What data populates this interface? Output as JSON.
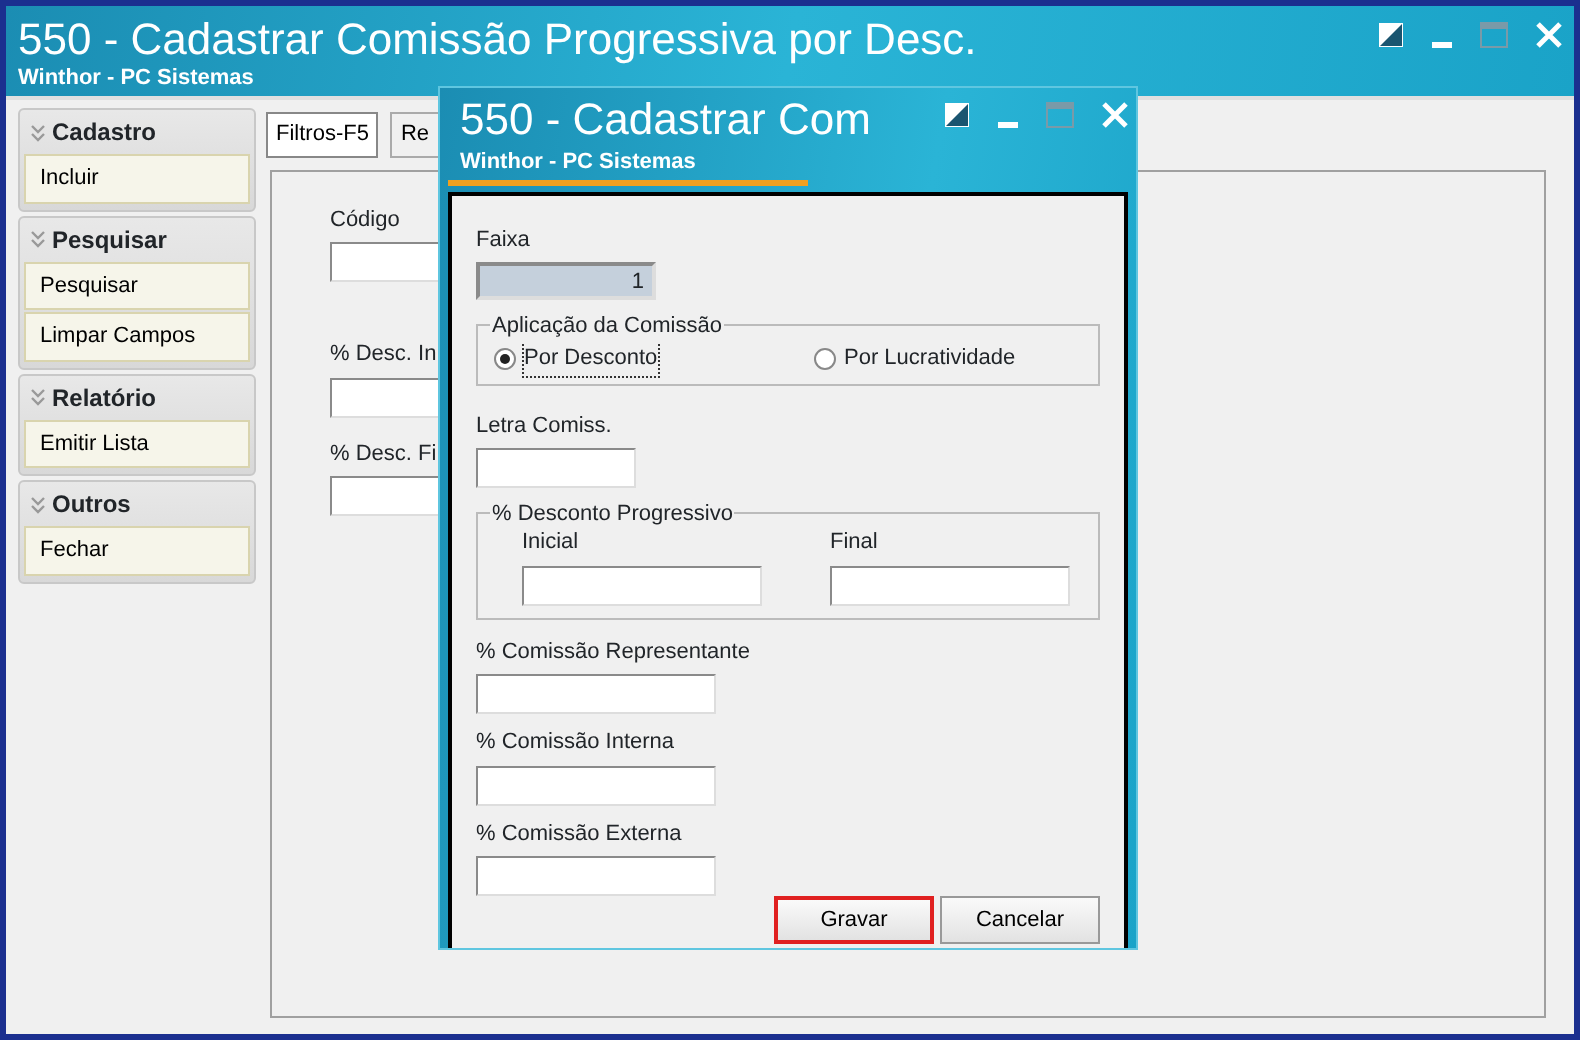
{
  "window": {
    "title": "550 - Cadastrar Comissão Progressiva por Desc.",
    "subtitle": "Winthor - PC Sistemas"
  },
  "sidebar": [
    {
      "title": "Cadastro",
      "items": [
        "Incluir"
      ]
    },
    {
      "title": "Pesquisar",
      "items": [
        "Pesquisar",
        "Limpar Campos"
      ]
    },
    {
      "title": "Relatório",
      "items": [
        "Emitir Lista"
      ]
    },
    {
      "title": "Outros",
      "items": [
        "Fechar"
      ]
    }
  ],
  "tabs": [
    {
      "label": "Filtros-F5",
      "selected": true
    },
    {
      "label": "Re",
      "selected": false
    }
  ],
  "filters": [
    {
      "label": "Código"
    },
    {
      "label": "% Desc. In"
    },
    {
      "label": "% Desc. Fi"
    }
  ],
  "dialog": {
    "title": "550 - Cadastrar Com",
    "subtitle": "Winthor - PC Sistemas",
    "faixa": {
      "label": "Faixa",
      "value": "1",
      "disabled": true
    },
    "aplicacao": {
      "legend": "Aplicação da Comissão",
      "options": [
        {
          "label": "Por Desconto",
          "selected": true
        },
        {
          "label": "Por Lucratividade",
          "selected": false
        }
      ]
    },
    "letra": {
      "label": "Letra Comiss."
    },
    "desconto": {
      "legend": "% Desconto Progressivo",
      "fields": [
        {
          "label": "Inicial"
        },
        {
          "label": "Final"
        }
      ]
    },
    "comissoes": [
      {
        "label": "% Comissão Representante"
      },
      {
        "label": "% Comissão Interna"
      },
      {
        "label": "% Comissão Externa"
      }
    ],
    "buttons": [
      {
        "label": "Gravar",
        "highlighted": true
      },
      {
        "label": "Cancelar",
        "highlighted": false
      }
    ]
  }
}
